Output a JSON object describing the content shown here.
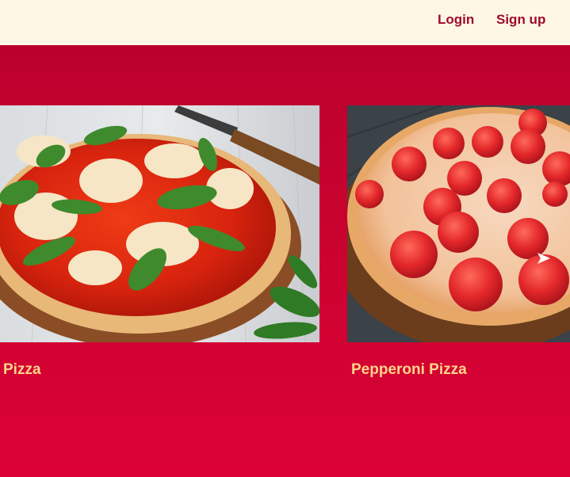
{
  "header": {
    "login_label": "Login",
    "signup_label": "Sign up"
  },
  "menu": {
    "items": [
      {
        "title": "Pizza",
        "image_icon": "margherita-pizza-photo"
      },
      {
        "title": "Pepperoni Pizza",
        "image_icon": "pepperoni-pizza-photo"
      }
    ]
  },
  "colors": {
    "header_bg": "#fff7e6",
    "nav_text": "#9e0a2c",
    "page_bg": "#c8022f",
    "card_title": "#ffd58a"
  }
}
